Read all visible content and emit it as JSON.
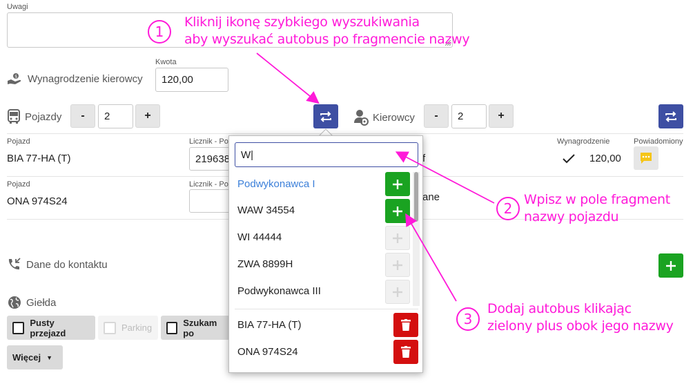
{
  "notes": {
    "label": "Uwagi"
  },
  "driver_pay": {
    "label": "Wynagrodzenie kierowcy",
    "amount_label": "Kwota",
    "amount_value": "120,00"
  },
  "vehicles": {
    "label": "Pojazdy",
    "count": "2",
    "minus": "-",
    "plus": "+"
  },
  "drivers": {
    "label": "Kierowcy",
    "count": "2",
    "minus": "-",
    "plus": "+"
  },
  "vehicle_rows": [
    {
      "col_label": "Pojazd",
      "name": "BIA 77-HA (T)",
      "counter_label": "Licznik - Po",
      "counter_value": "219638"
    },
    {
      "col_label": "Pojazd",
      "name": "ONA 974S24",
      "counter_label": "Licznik - Po",
      "counter_value": ""
    }
  ],
  "driver_table": {
    "pay_header": "Wynagrodzenie",
    "notified_header": "Powiadomiony",
    "row1_suffix": "f",
    "row1_pay": "120,00",
    "row2_suffix": "ane"
  },
  "contact": {
    "label": "Dane do kontaktu"
  },
  "exchange": {
    "label": "Giełda",
    "chips": [
      "Pusty przejazd",
      "Parking",
      "Szukam po"
    ],
    "more": "Więcej"
  },
  "search_dropdown": {
    "query": "W|",
    "results": [
      {
        "name": "Podwykonawca I",
        "highlight": true,
        "enabled": true
      },
      {
        "name": "WAW 34554",
        "highlight": false,
        "enabled": true
      },
      {
        "name": "WI 44444",
        "highlight": false,
        "enabled": false
      },
      {
        "name": "ZWA 8899H",
        "highlight": false,
        "enabled": false
      },
      {
        "name": "Podwykonawca III",
        "highlight": false,
        "enabled": false
      }
    ],
    "selected": [
      "BIA 77-HA (T)",
      "ONA 974S24"
    ]
  },
  "annotations": [
    {
      "number": "1",
      "line1": "Kliknij ikonę szybkiego wyszukiwania",
      "line2": "aby wyszukać autobus po fragmencie nazwy"
    },
    {
      "number": "2",
      "line1": "Wpisz w pole fragment",
      "line2": "nazwy pojazdu"
    },
    {
      "number": "3",
      "line1": "Dodaj autobus klikając",
      "line2": "zielony plus obok jego nazwy"
    }
  ],
  "colors": {
    "accent_blue": "#3e4fa3",
    "add_green": "#1aa321",
    "delete_red": "#d40f0f",
    "annotation_magenta": "#ff1ad9",
    "link_blue": "#3b7fd9"
  },
  "icons": [
    "swap-icon",
    "plus-icon",
    "trash-icon",
    "chat-icon",
    "check-icon",
    "bus-icon",
    "driver-icon",
    "phone-icon",
    "globe-icon",
    "hand-money-icon",
    "caret-down-icon"
  ]
}
